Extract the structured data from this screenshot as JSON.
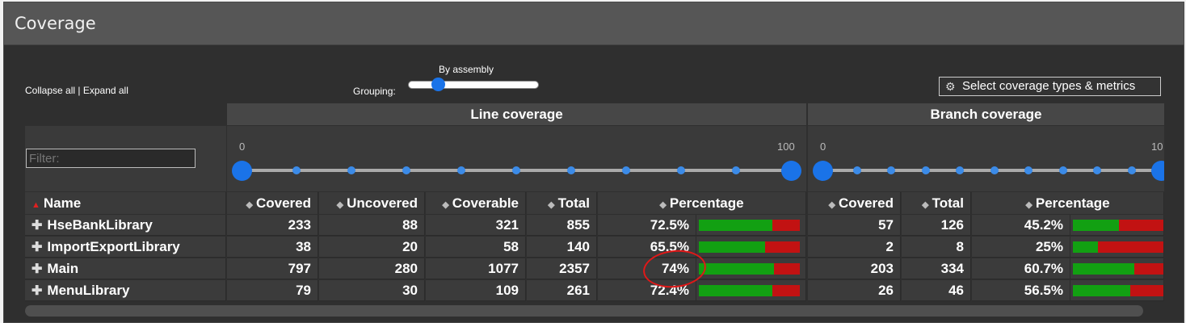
{
  "header": {
    "title": "Coverage"
  },
  "toolbar": {
    "collapse_all": "Collapse all",
    "separator": " | ",
    "expand_all": "Expand all",
    "grouping_label": "Grouping:",
    "grouping_value": "By assembly",
    "select_metrics": "Select coverage types & metrics"
  },
  "filter": {
    "placeholder": "Filter:"
  },
  "groups": {
    "line": "Line coverage",
    "branch": "Branch coverage"
  },
  "line_range": {
    "min": "0",
    "max": "100"
  },
  "branch_range": {
    "min": "0",
    "max": "10"
  },
  "columns": {
    "name": "Name",
    "covered": "Covered",
    "uncovered": "Uncovered",
    "coverable": "Coverable",
    "total": "Total",
    "percentage": "Percentage",
    "b_covered": "Covered",
    "b_total": "Total",
    "b_percentage": "Percentage"
  },
  "rows": [
    {
      "name": "HseBankLibrary",
      "covered": "233",
      "uncovered": "88",
      "coverable": "321",
      "total": "855",
      "percentage": "72.5%",
      "b_covered": "57",
      "b_total": "126",
      "b_percentage": "45.2%"
    },
    {
      "name": "ImportExportLibrary",
      "covered": "38",
      "uncovered": "20",
      "coverable": "58",
      "total": "140",
      "percentage": "65.5%",
      "b_covered": "2",
      "b_total": "8",
      "b_percentage": "25%"
    },
    {
      "name": "Main",
      "covered": "797",
      "uncovered": "280",
      "coverable": "1077",
      "total": "2357",
      "percentage": "74%",
      "b_covered": "203",
      "b_total": "334",
      "b_percentage": "60.7%"
    },
    {
      "name": "MenuLibrary",
      "covered": "79",
      "uncovered": "30",
      "coverable": "109",
      "total": "261",
      "percentage": "72.4%",
      "b_covered": "26",
      "b_total": "46",
      "b_percentage": "56.5%"
    }
  ],
  "line_fractions": [
    0.725,
    0.655,
    0.74,
    0.724
  ],
  "branch_fractions": [
    0.452,
    0.25,
    0.607,
    0.565
  ],
  "colors": {
    "covered": "#12a012",
    "uncovered": "#c21212",
    "accent": "#1a73e8",
    "annotation": "#e01818"
  }
}
